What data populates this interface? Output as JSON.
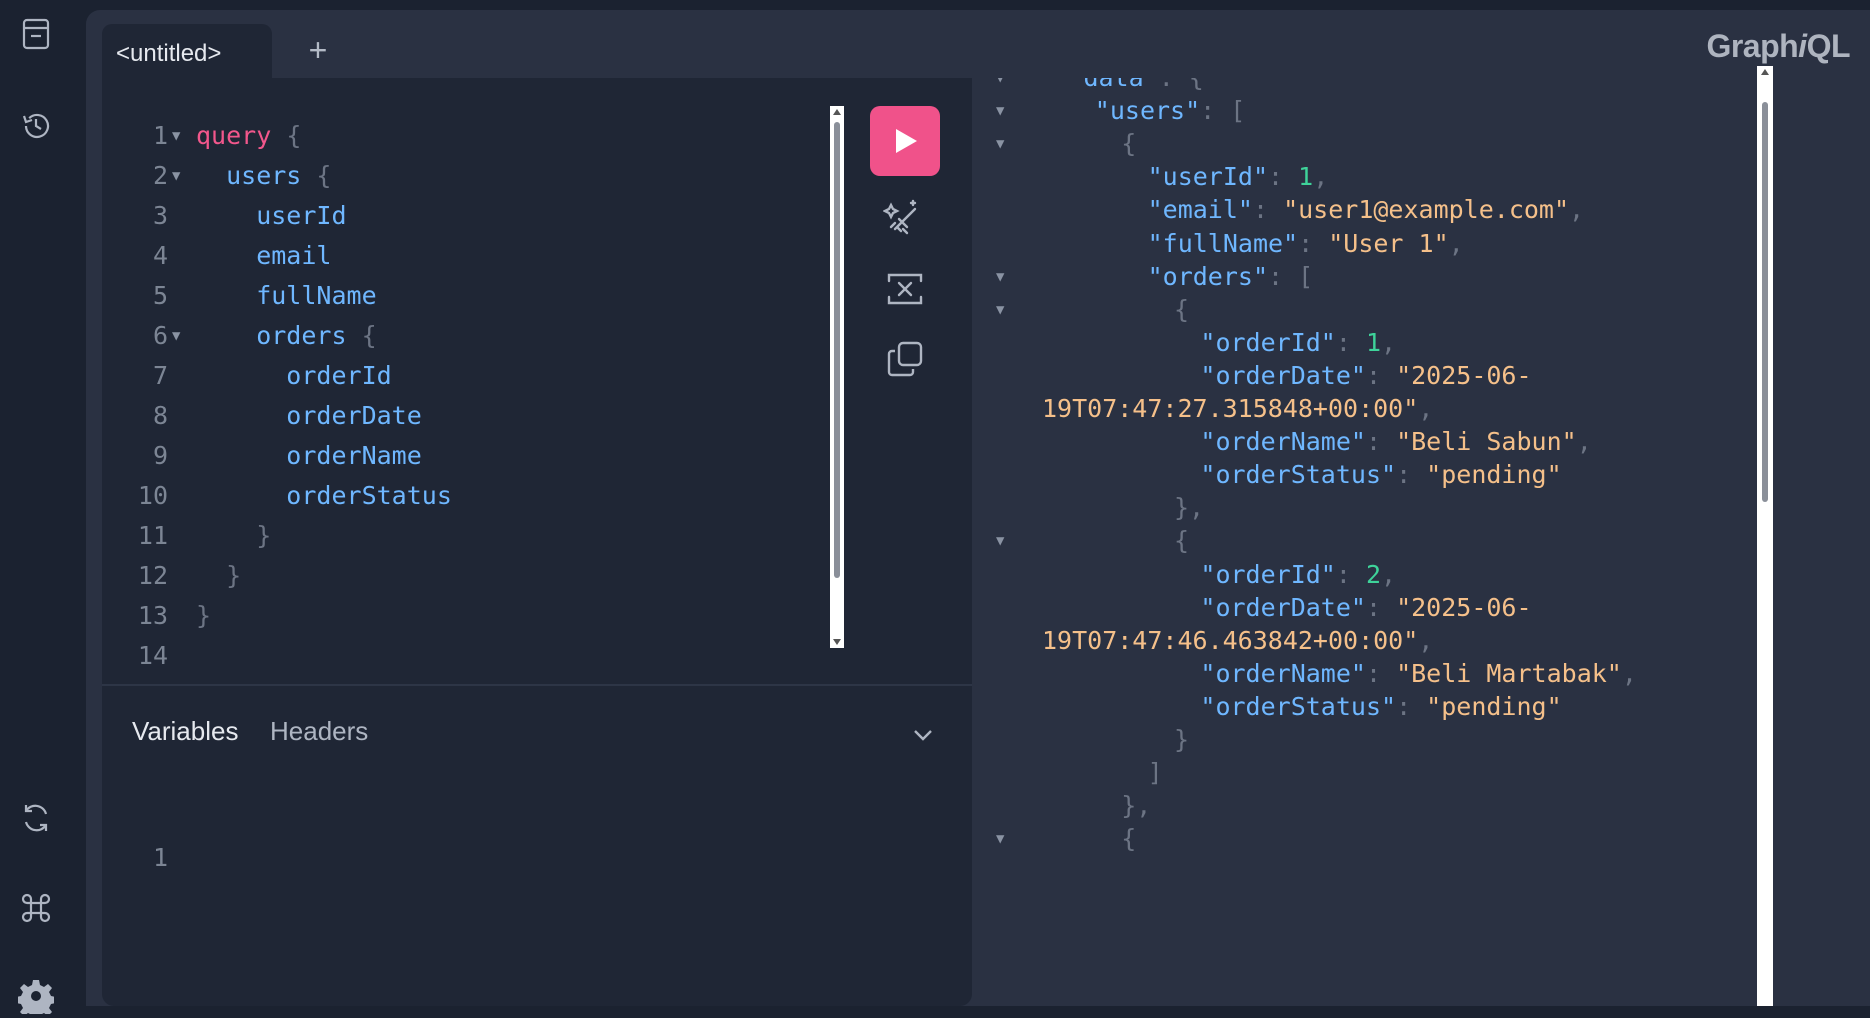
{
  "tabs": [
    {
      "label": "<untitled>"
    }
  ],
  "add_tab_label": "+",
  "logo": {
    "prefix": "Graph",
    "italic": "i",
    "suffix": "QL"
  },
  "query": {
    "lines": [
      {
        "n": "1",
        "fold": true,
        "text": "query",
        "cls": "kw",
        "tail": " {"
      },
      {
        "n": "2",
        "fold": true,
        "text": "  users",
        "cls": "fld",
        "tail": " {"
      },
      {
        "n": "3",
        "fold": false,
        "text": "    userId",
        "cls": "fld",
        "tail": ""
      },
      {
        "n": "4",
        "fold": false,
        "text": "    email",
        "cls": "fld",
        "tail": ""
      },
      {
        "n": "5",
        "fold": false,
        "text": "    fullName",
        "cls": "fld",
        "tail": ""
      },
      {
        "n": "6",
        "fold": true,
        "text": "    orders",
        "cls": "fld",
        "tail": " {"
      },
      {
        "n": "7",
        "fold": false,
        "text": "      orderId",
        "cls": "fld",
        "tail": ""
      },
      {
        "n": "8",
        "fold": false,
        "text": "      orderDate",
        "cls": "fld",
        "tail": ""
      },
      {
        "n": "9",
        "fold": false,
        "text": "      orderName",
        "cls": "fld",
        "tail": ""
      },
      {
        "n": "10",
        "fold": false,
        "text": "      orderStatus",
        "cls": "fld",
        "tail": ""
      },
      {
        "n": "11",
        "fold": false,
        "text": "    }",
        "cls": "pn",
        "tail": ""
      },
      {
        "n": "12",
        "fold": false,
        "text": "  }",
        "cls": "pn",
        "tail": ""
      },
      {
        "n": "13",
        "fold": false,
        "text": "}",
        "cls": "pn",
        "tail": ""
      },
      {
        "n": "14",
        "fold": false,
        "text": "",
        "cls": "pn",
        "tail": ""
      }
    ]
  },
  "bottom_tabs": {
    "variables": "Variables",
    "headers": "Headers"
  },
  "variables_editor": {
    "line_number": "1"
  },
  "result": {
    "lines": [
      {
        "fold": true,
        "indent": 2,
        "parts": [
          [
            "key",
            "\"data\""
          ],
          [
            "pn",
            ": {"
          ]
        ]
      },
      {
        "fold": true,
        "indent": 4,
        "parts": [
          [
            "key",
            "\"users\""
          ],
          [
            "pn",
            ": ["
          ]
        ]
      },
      {
        "fold": true,
        "indent": 6,
        "parts": [
          [
            "pn",
            "{"
          ]
        ]
      },
      {
        "fold": false,
        "indent": 8,
        "parts": [
          [
            "key",
            "\"userId\""
          ],
          [
            "pn",
            ": "
          ],
          [
            "num",
            "1"
          ],
          [
            "pn",
            ","
          ]
        ]
      },
      {
        "fold": false,
        "indent": 8,
        "parts": [
          [
            "key",
            "\"email\""
          ],
          [
            "pn",
            ": "
          ],
          [
            "str",
            "\"user1@example.com\""
          ],
          [
            "pn",
            ","
          ]
        ]
      },
      {
        "fold": false,
        "indent": 8,
        "parts": [
          [
            "key",
            "\"fullName\""
          ],
          [
            "pn",
            ": "
          ],
          [
            "str",
            "\"User 1\""
          ],
          [
            "pn",
            ","
          ]
        ]
      },
      {
        "fold": true,
        "indent": 8,
        "parts": [
          [
            "key",
            "\"orders\""
          ],
          [
            "pn",
            ": ["
          ]
        ]
      },
      {
        "fold": true,
        "indent": 10,
        "parts": [
          [
            "pn",
            "{"
          ]
        ]
      },
      {
        "fold": false,
        "indent": 12,
        "parts": [
          [
            "key",
            "\"orderId\""
          ],
          [
            "pn",
            ": "
          ],
          [
            "num",
            "1"
          ],
          [
            "pn",
            ","
          ]
        ]
      },
      {
        "fold": false,
        "indent": 12,
        "parts": [
          [
            "key",
            "\"orderDate\""
          ],
          [
            "pn",
            ": "
          ],
          [
            "str",
            "\"2025-06-"
          ]
        ]
      },
      {
        "fold": false,
        "indent": 0,
        "parts": [
          [
            "str",
            "19T07:47:27.315848+00:00\""
          ],
          [
            "pn",
            ","
          ]
        ]
      },
      {
        "fold": false,
        "indent": 12,
        "parts": [
          [
            "key",
            "\"orderName\""
          ],
          [
            "pn",
            ": "
          ],
          [
            "str",
            "\"Beli Sabun\""
          ],
          [
            "pn",
            ","
          ]
        ]
      },
      {
        "fold": false,
        "indent": 12,
        "parts": [
          [
            "key",
            "\"orderStatus\""
          ],
          [
            "pn",
            ": "
          ],
          [
            "str",
            "\"pending\""
          ]
        ]
      },
      {
        "fold": false,
        "indent": 10,
        "parts": [
          [
            "pn",
            "},"
          ]
        ]
      },
      {
        "fold": true,
        "indent": 10,
        "parts": [
          [
            "pn",
            "{"
          ]
        ]
      },
      {
        "fold": false,
        "indent": 12,
        "parts": [
          [
            "key",
            "\"orderId\""
          ],
          [
            "pn",
            ": "
          ],
          [
            "num",
            "2"
          ],
          [
            "pn",
            ","
          ]
        ]
      },
      {
        "fold": false,
        "indent": 12,
        "parts": [
          [
            "key",
            "\"orderDate\""
          ],
          [
            "pn",
            ": "
          ],
          [
            "str",
            "\"2025-06-"
          ]
        ]
      },
      {
        "fold": false,
        "indent": 0,
        "parts": [
          [
            "str",
            "19T07:47:46.463842+00:00\""
          ],
          [
            "pn",
            ","
          ]
        ]
      },
      {
        "fold": false,
        "indent": 12,
        "parts": [
          [
            "key",
            "\"orderName\""
          ],
          [
            "pn",
            ": "
          ],
          [
            "str",
            "\"Beli Martabak\""
          ],
          [
            "pn",
            ","
          ]
        ]
      },
      {
        "fold": false,
        "indent": 12,
        "parts": [
          [
            "key",
            "\"orderStatus\""
          ],
          [
            "pn",
            ": "
          ],
          [
            "str",
            "\"pending\""
          ]
        ]
      },
      {
        "fold": false,
        "indent": 10,
        "parts": [
          [
            "pn",
            "}"
          ]
        ]
      },
      {
        "fold": false,
        "indent": 8,
        "parts": [
          [
            "pn",
            "]"
          ]
        ]
      },
      {
        "fold": false,
        "indent": 6,
        "parts": [
          [
            "pn",
            "},"
          ]
        ]
      },
      {
        "fold": true,
        "indent": 6,
        "parts": [
          [
            "pn",
            "{"
          ]
        ]
      }
    ]
  },
  "colors": {
    "accent": "#f0528a",
    "background": "#1b2230",
    "panel": "#1f2635",
    "keyword": "#f2578c",
    "field": "#6fb7ff",
    "string": "#f5c08a",
    "number": "#3ed39a"
  },
  "icons": {
    "rail": [
      "docs-icon",
      "history-icon",
      "refetch-schema-icon",
      "shortcuts-icon",
      "settings-icon"
    ],
    "toolbar": [
      "play-icon",
      "prettify-icon",
      "merge-fragments-icon",
      "copy-icon"
    ]
  }
}
